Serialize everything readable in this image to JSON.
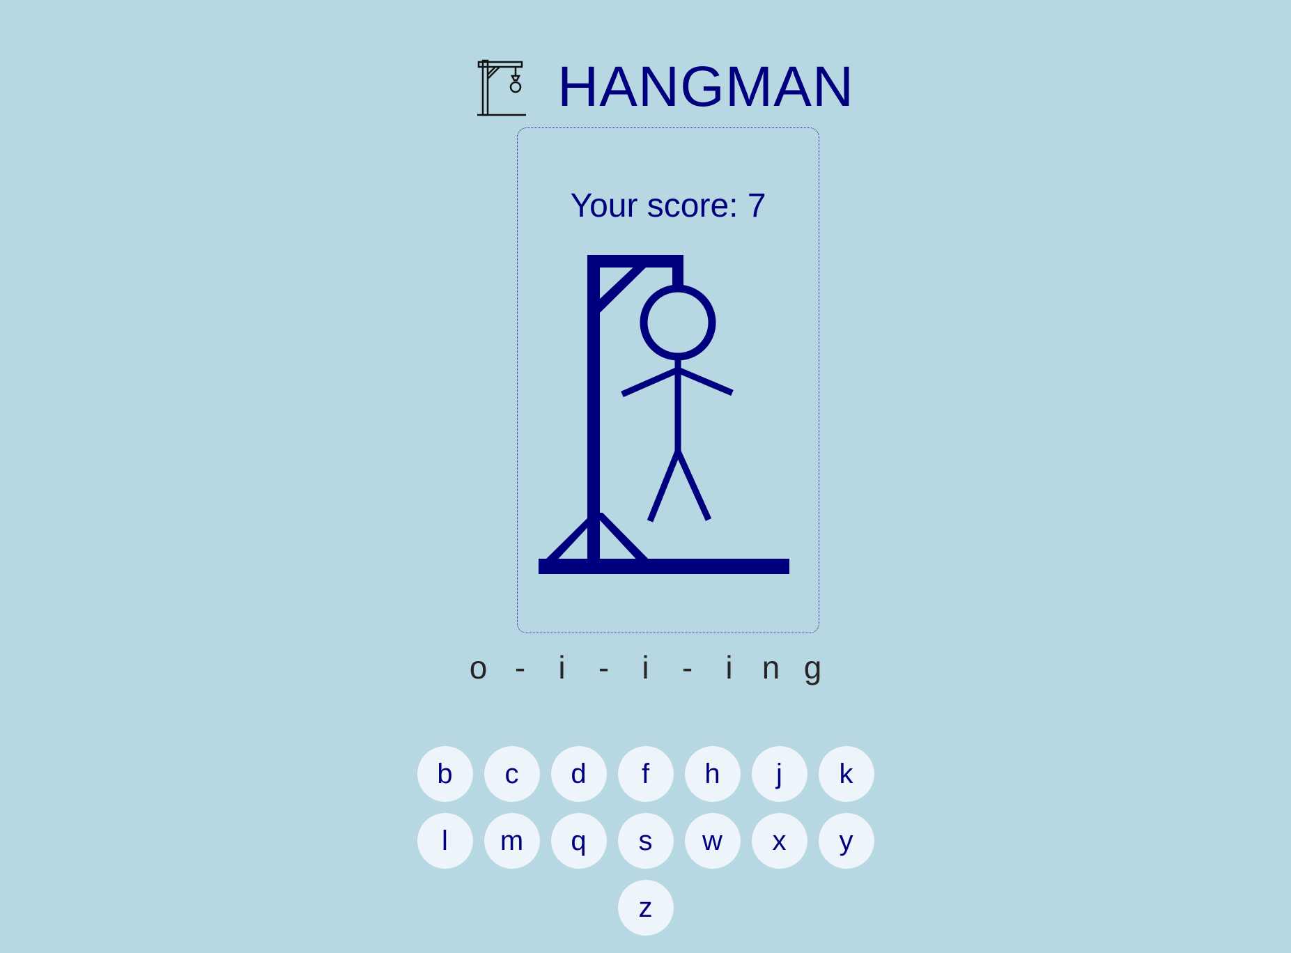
{
  "app": {
    "title": "HANGMAN",
    "logo_icon": "gallows-icon"
  },
  "game": {
    "score_text": "Your score: 7",
    "wrong_guesses_drawn": 6,
    "word_display": [
      "o",
      "-",
      "i",
      "-",
      "i",
      "-",
      "i",
      "n",
      "g"
    ]
  },
  "keyboard": {
    "rows": [
      [
        "b",
        "c",
        "d",
        "f",
        "h",
        "j",
        "k"
      ],
      [
        "l",
        "m",
        "q",
        "s",
        "w",
        "x",
        "y"
      ],
      [
        "z"
      ]
    ]
  },
  "colors": {
    "background": "#b7d7e3",
    "accent": "#00007f",
    "key_background": "#eef5fa",
    "word_text": "#262626"
  }
}
